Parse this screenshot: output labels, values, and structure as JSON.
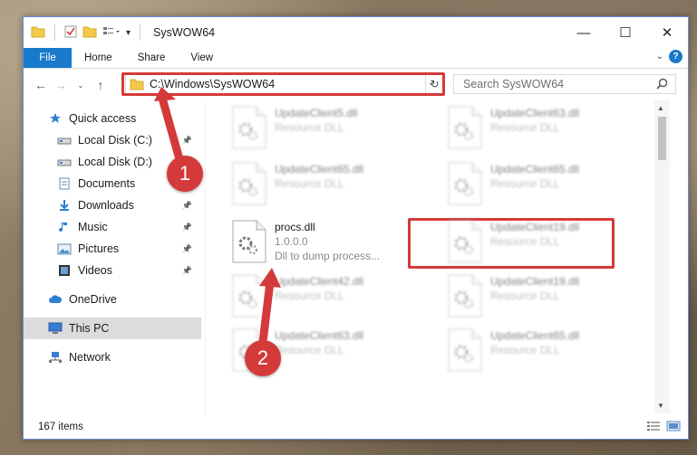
{
  "window": {
    "title": "SysWOW64",
    "controls": {
      "minimize": "—",
      "maximize": "☐",
      "close": "✕"
    }
  },
  "ribbon": {
    "file": "File",
    "tabs": [
      "Home",
      "Share",
      "View"
    ]
  },
  "address": {
    "path": "C:\\Windows\\SysWOW64"
  },
  "search": {
    "placeholder": "Search SysWOW64"
  },
  "nav": {
    "items": [
      {
        "label": "Quick access",
        "icon": "star-icon",
        "pinned": false
      },
      {
        "label": "Local Disk (C:)",
        "icon": "drive-icon",
        "pinned": true
      },
      {
        "label": "Local Disk (D:)",
        "icon": "drive-icon",
        "pinned": false
      },
      {
        "label": "Documents",
        "icon": "documents-icon",
        "pinned": true
      },
      {
        "label": "Downloads",
        "icon": "download-icon",
        "pinned": true
      },
      {
        "label": "Music",
        "icon": "music-icon",
        "pinned": true
      },
      {
        "label": "Pictures",
        "icon": "pictures-icon",
        "pinned": true
      },
      {
        "label": "Videos",
        "icon": "videos-icon",
        "pinned": true
      },
      {
        "label": "OneDrive",
        "icon": "cloud-icon",
        "pinned": false
      },
      {
        "label": "This PC",
        "icon": "computer-icon",
        "pinned": false,
        "selected": true
      },
      {
        "label": "Network",
        "icon": "network-icon",
        "pinned": false
      }
    ]
  },
  "files": [
    {
      "name": "UpdateClient5.dll",
      "sub": "Resource DLL",
      "sub2": ""
    },
    {
      "name": "UpdateClient63.dll",
      "sub": "Resource DLL",
      "sub2": ""
    },
    {
      "name": "UpdateClient65.dll",
      "sub": "Resource DLL",
      "sub2": ""
    },
    {
      "name": "UpdateClient65.dll",
      "sub": "Resource DLL",
      "sub2": ""
    },
    {
      "name": "procs.dll",
      "sub": "1.0.0.0",
      "sub2": "Dll to dump process..."
    },
    {
      "name": "UpdateClient19.dll",
      "sub": "Resource DLL",
      "sub2": ""
    },
    {
      "name": "UpdateClient42.dll",
      "sub": "Resource DLL",
      "sub2": ""
    },
    {
      "name": "UpdateClient19.dll",
      "sub": "Resource DLL",
      "sub2": ""
    },
    {
      "name": "UpdateClient63.dll",
      "sub": "Resource DLL",
      "sub2": ""
    },
    {
      "name": "UpdateClient65.dll",
      "sub": "Resource DLL",
      "sub2": ""
    }
  ],
  "status": {
    "count": "167 items"
  },
  "markers": [
    "1",
    "2"
  ],
  "colors": {
    "accent": "#1979ca",
    "highlight": "#d43a3a"
  }
}
